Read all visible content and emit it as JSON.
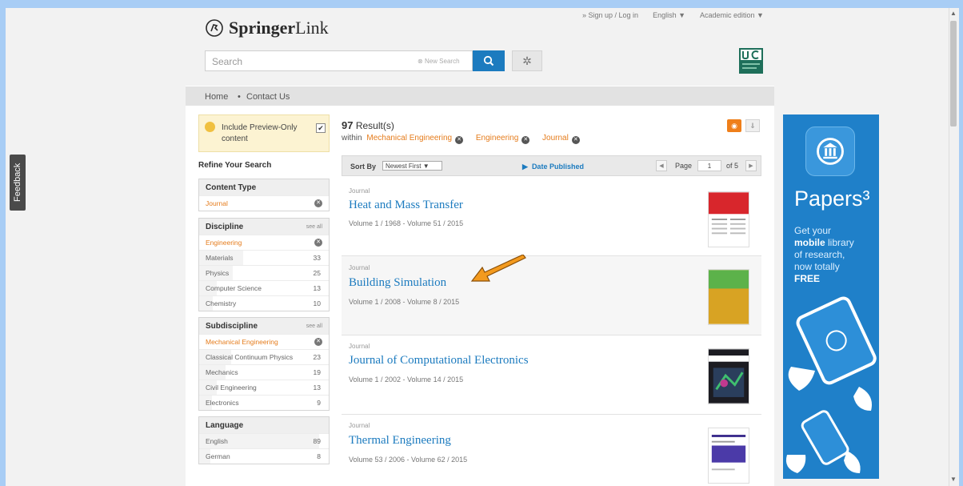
{
  "feedback": "Feedback",
  "header": {
    "logo_brand": "Springer",
    "logo_suffix": "Link",
    "signup": "» Sign up / Log in",
    "language": "English ▼",
    "edition": "Academic edition ▼",
    "search_placeholder": "Search",
    "new_search": "New Search"
  },
  "breadcrumb": {
    "home": "Home",
    "sep": "•",
    "contact": "Contact Us"
  },
  "preview": {
    "label": "Include Preview-Only content",
    "check": "✔"
  },
  "refine_title": "Refine Your Search",
  "facets": {
    "content_type": {
      "title": "Content Type",
      "items": [
        {
          "label": "Journal"
        }
      ]
    },
    "discipline": {
      "title": "Discipline",
      "see_all": "see all",
      "items": [
        {
          "label": "Engineering"
        },
        {
          "label": "Materials",
          "count": "33"
        },
        {
          "label": "Physics",
          "count": "25"
        },
        {
          "label": "Computer Science",
          "count": "13"
        },
        {
          "label": "Chemistry",
          "count": "10"
        }
      ]
    },
    "subdiscipline": {
      "title": "Subdiscipline",
      "see_all": "see all",
      "items": [
        {
          "label": "Mechanical Engineering"
        },
        {
          "label": "Classical Continuum Physics",
          "count": "23"
        },
        {
          "label": "Mechanics",
          "count": "19"
        },
        {
          "label": "Civil Engineering",
          "count": "13"
        },
        {
          "label": "Electronics",
          "count": "9"
        }
      ]
    },
    "language": {
      "title": "Language",
      "items": [
        {
          "label": "English",
          "count": "89"
        },
        {
          "label": "German",
          "count": "8"
        }
      ]
    }
  },
  "results": {
    "count": "97",
    "count_label": "Result(s)",
    "within": "within",
    "filters": [
      "Mechanical Engineering",
      "Engineering",
      "Journal"
    ],
    "sort_by": "Sort By",
    "sort_value": "Newest First",
    "date_published": "Date Published",
    "page_label": "Page",
    "page_value": "1",
    "page_of": "of 5",
    "items": [
      {
        "type": "Journal",
        "title": "Heat and Mass Transfer",
        "meta": "Volume 1 / 1968 - Volume 51 / 2015"
      },
      {
        "type": "Journal",
        "title": "Building Simulation",
        "meta": "Volume 1 / 2008 - Volume 8 / 2015"
      },
      {
        "type": "Journal",
        "title": "Journal of Computational Electronics",
        "meta": "Volume 1 / 2002 - Volume 14 / 2015"
      },
      {
        "type": "Journal",
        "title": "Thermal Engineering",
        "meta": "Volume 53 / 2006 - Volume 62 / 2015"
      }
    ]
  },
  "ad": {
    "brand": "Papers³",
    "line1": "Get your",
    "line2_bold": "mobile",
    "line2_rest": "library",
    "line3": "of research,",
    "line4": "now totally",
    "line5": "FREE"
  },
  "colors": {
    "accent": "#1c7bbf",
    "facet_active": "#e57c1c",
    "rss": "#ef7f1a",
    "ad_bg": "#1f80c9",
    "arrow": "#f39a1e"
  }
}
